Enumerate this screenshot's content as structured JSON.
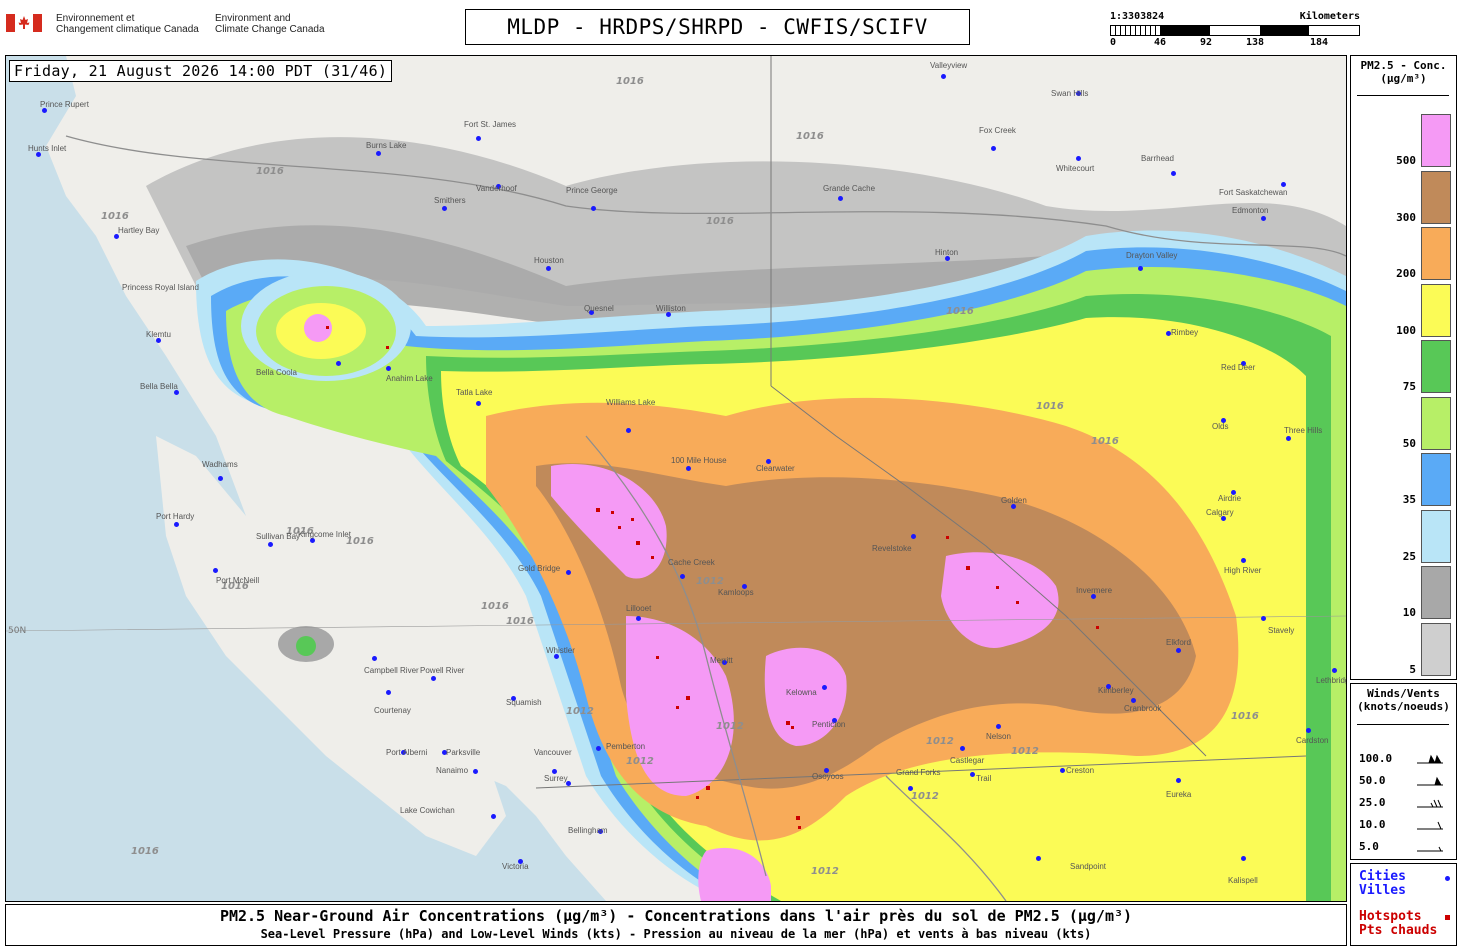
{
  "header": {
    "agency_fr": [
      "Environnement et",
      "Changement climatique Canada"
    ],
    "agency_en": [
      "Environment and",
      "Climate Change Canada"
    ],
    "title": "MLDP - HRDPS/SHRPD - CWFIS/SCIFV"
  },
  "scale": {
    "ratio": "1:3303824",
    "units": "Kilometers",
    "ticks": [
      "0",
      "46",
      "92",
      "138",
      "184"
    ]
  },
  "map": {
    "timestamp": "Friday, 21 August 2026 14:00 PDT (31/46)",
    "latitude_label": "50N",
    "isobar_labels": [
      "1016",
      "1016",
      "1016",
      "1016",
      "1016",
      "1016",
      "1016",
      "1016",
      "1016",
      "1016",
      "1016",
      "1016",
      "1016",
      "1012",
      "1012",
      "1012",
      "1012",
      "1012",
      "1012",
      "1012",
      "1012",
      "1016",
      "1016"
    ],
    "cities": [
      "Prince Rupert",
      "Hunts Inlet",
      "Hartley Bay",
      "Princess Royal Island",
      "Klemtu",
      "Bella Bella",
      "Wadhams",
      "Sullivan Bay",
      "Kingcome Inlet",
      "Port McNeill",
      "Campbell River",
      "Courtenay",
      "Port Alberni",
      "Parksville",
      "Nanaimo",
      "Lake Cowichan",
      "Victoria",
      "Bellingham",
      "Vancouver",
      "Surrey",
      "Squamish",
      "Powell River",
      "Whistler",
      "Gold Bridge",
      "Cache Creek",
      "Kamloops",
      "Merritt",
      "Kelowna",
      "Penticton",
      "Osoyoos",
      "Grand Forks",
      "Castlegar",
      "Trail",
      "Nelson",
      "Creston",
      "Cranbrook",
      "Elkford",
      "Kimberley",
      "Invermere",
      "Golden",
      "Revelstoke",
      "Clearwater",
      "100 Mile House",
      "Williams Lake",
      "Quesnel",
      "Williston",
      "Prince George",
      "Vanderhoof",
      "Burns Lake",
      "Fort St. James",
      "Grande Cache",
      "Hinton",
      "Valleyview",
      "Swan Hills",
      "Fox Creek",
      "Barrhead",
      "Whitecourt",
      "Fort Saskatchewan",
      "Edmonton",
      "Drayton Valley",
      "Rimbey",
      "Red Deer",
      "Olds",
      "Three Hills",
      "Airdrie",
      "Calgary",
      "High River",
      "Stavely",
      "Lethbridge",
      "Cardston",
      "Eureka",
      "Kalispell",
      "Sandpoint",
      "Bella Coola",
      "Anahim Lake",
      "Tatla Lake",
      "Pemberton",
      "Lillooet",
      "Port Hardy",
      "Smithers",
      "Houston"
    ],
    "fire_colors": {
      "5": "#cfcfcf",
      "10": "#a8a8a8",
      "25": "#b9e5f7",
      "35": "#5aaaf6",
      "50": "#b7ef67",
      "75": "#58c857",
      "100": "#fbfb56",
      "200": "#f8ab59",
      "300": "#c08a5a",
      "500": "#f59af5"
    },
    "hotspot_color": "#cc0000",
    "city_dot_color": "#1a1aff"
  },
  "caption": {
    "line1": "PM2.5 Near-Ground Air Concentrations (µg/m³) - Concentrations dans l'air près du sol de PM2.5 (µg/m³)",
    "line2": "Sea-Level Pressure (hPa) and Low-Level Winds (kts) - Pression au niveau de la mer (hPa) et vents à bas niveau (kts)"
  },
  "legend_pm": {
    "title": [
      "PM2.5 - Conc.",
      "(µg/m³)"
    ],
    "levels": [
      {
        "label": "500",
        "color": "#f59af5"
      },
      {
        "label": "300",
        "color": "#c08a5a"
      },
      {
        "label": "200",
        "color": "#f8ab59"
      },
      {
        "label": "100",
        "color": "#fbfb56"
      },
      {
        "label": "75",
        "color": "#58c857"
      },
      {
        "label": "50",
        "color": "#b7ef67"
      },
      {
        "label": "35",
        "color": "#5aaaf6"
      },
      {
        "label": "25",
        "color": "#b9e5f7"
      },
      {
        "label": "10",
        "color": "#a8a8a8"
      },
      {
        "label": "5",
        "color": "#cfcfcf"
      }
    ]
  },
  "legend_wind": {
    "title": [
      "Winds/Vents",
      "(knots/noeuds)"
    ],
    "rows": [
      "100.0",
      "50.0",
      "25.0",
      "10.0",
      "5.0"
    ]
  },
  "legend_points": {
    "cities_en": "Cities",
    "cities_fr": "Villes",
    "hotspots_en": "Hotspots",
    "hotspots_fr": "Pts chauds",
    "cities_color": "#1a1aff",
    "hotspots_color": "#cc0000"
  }
}
